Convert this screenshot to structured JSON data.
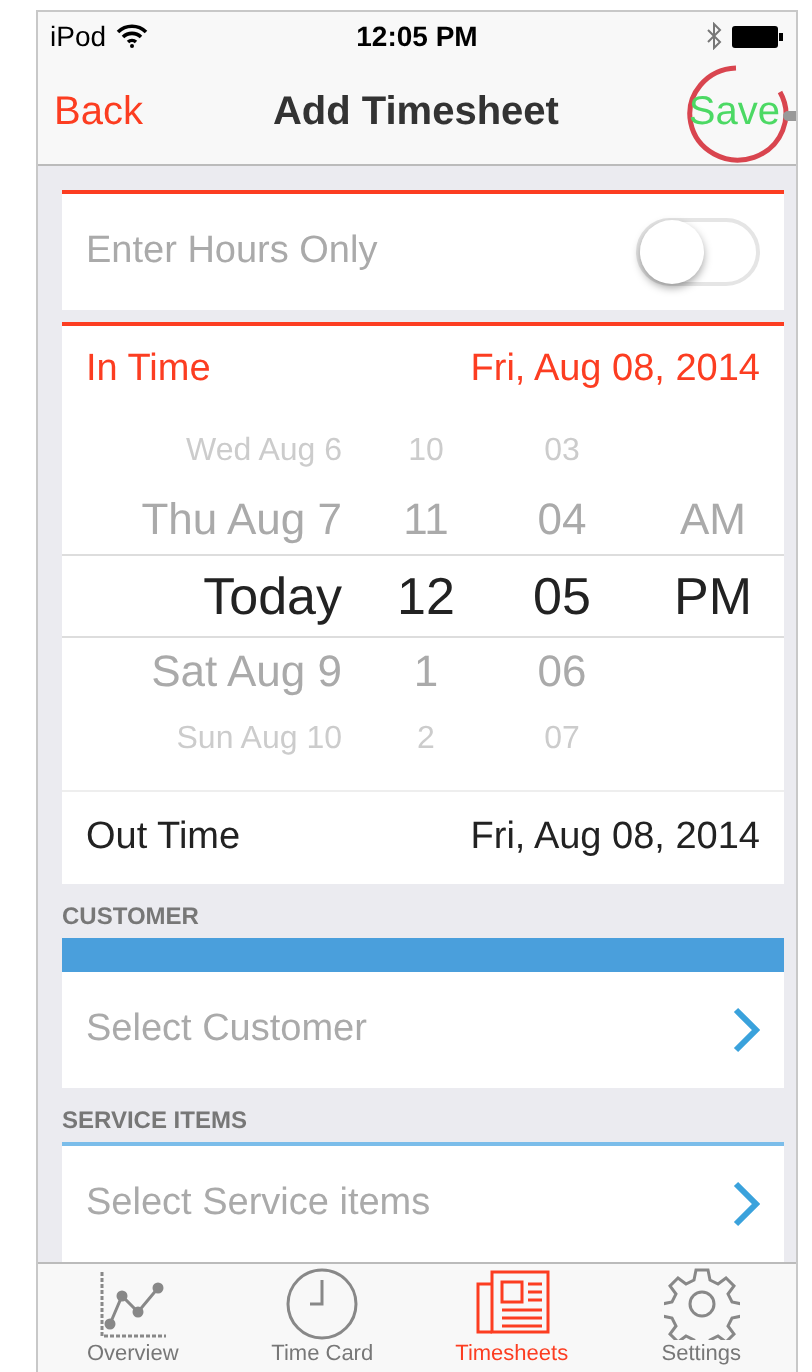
{
  "status_bar": {
    "carrier": "iPod",
    "time": "12:05 PM"
  },
  "nav": {
    "back": "Back",
    "title": "Add Timesheet",
    "action": "Save"
  },
  "hours_only": {
    "label": "Enter Hours Only",
    "on": false
  },
  "in_time": {
    "label": "In Time",
    "value": "Fri, Aug 08, 2014",
    "expanded": true
  },
  "picker": {
    "rows": [
      {
        "date": "Wed Aug 6",
        "hour": "10",
        "minute": "03",
        "selected": false
      },
      {
        "date": "Thu Aug 7",
        "hour": "11",
        "minute": "04",
        "period": "AM",
        "selected": false
      },
      {
        "date": "Today",
        "hour": "12",
        "minute": "05",
        "period": "PM",
        "selected": true
      },
      {
        "date": "Sat Aug 9",
        "hour": "1",
        "minute": "06",
        "selected": false
      },
      {
        "date": "Sun Aug 10",
        "hour": "2",
        "minute": "07",
        "selected": false
      }
    ]
  },
  "out_time": {
    "label": "Out Time",
    "value": "Fri, Aug 08, 2014",
    "expanded": false
  },
  "sections": [
    {
      "header": "CUSTOMER",
      "kind": "bar",
      "placeholder": "Select Customer"
    },
    {
      "header": "SERVICE ITEMS",
      "kind": "line",
      "placeholder": "Select Service items"
    }
  ],
  "tab_bar": [
    {
      "label": "Overview",
      "selected": false
    },
    {
      "label": "Time Card",
      "selected": false
    },
    {
      "label": "Timesheets",
      "selected": true
    },
    {
      "label": "Settings",
      "selected": false
    }
  ]
}
